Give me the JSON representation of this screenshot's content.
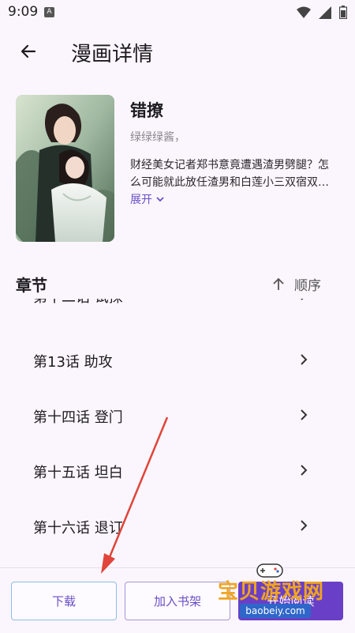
{
  "status_bar": {
    "time": "9:09",
    "badge": "A"
  },
  "app_bar": {
    "title": "漫画详情"
  },
  "manga": {
    "title": "错撩",
    "author": "绿绿绿酱，",
    "description": "财经美女记者郑书意竟遭遇渣男劈腿？怎么可能就此放任渣男和白莲小三双宿双…",
    "expand_label": "展开"
  },
  "chapters": {
    "heading": "章节",
    "sort_label": "顺序",
    "partial_top": "第十二话 试探",
    "items": [
      {
        "label": "第13话 助攻"
      },
      {
        "label": "第十四话 登门"
      },
      {
        "label": "第十五话 坦白"
      },
      {
        "label": "第十六话 退订"
      }
    ]
  },
  "actions": {
    "download_label": "下载",
    "bookshelf_label": "加入书架",
    "read_label": "开始阅读"
  },
  "watermark": {
    "text": "宝贝游戏网",
    "url": "baobeiy.com"
  },
  "colors": {
    "accent": "#6a3fc7",
    "background": "#fbf6fd",
    "annotation_arrow": "#e0443a"
  }
}
